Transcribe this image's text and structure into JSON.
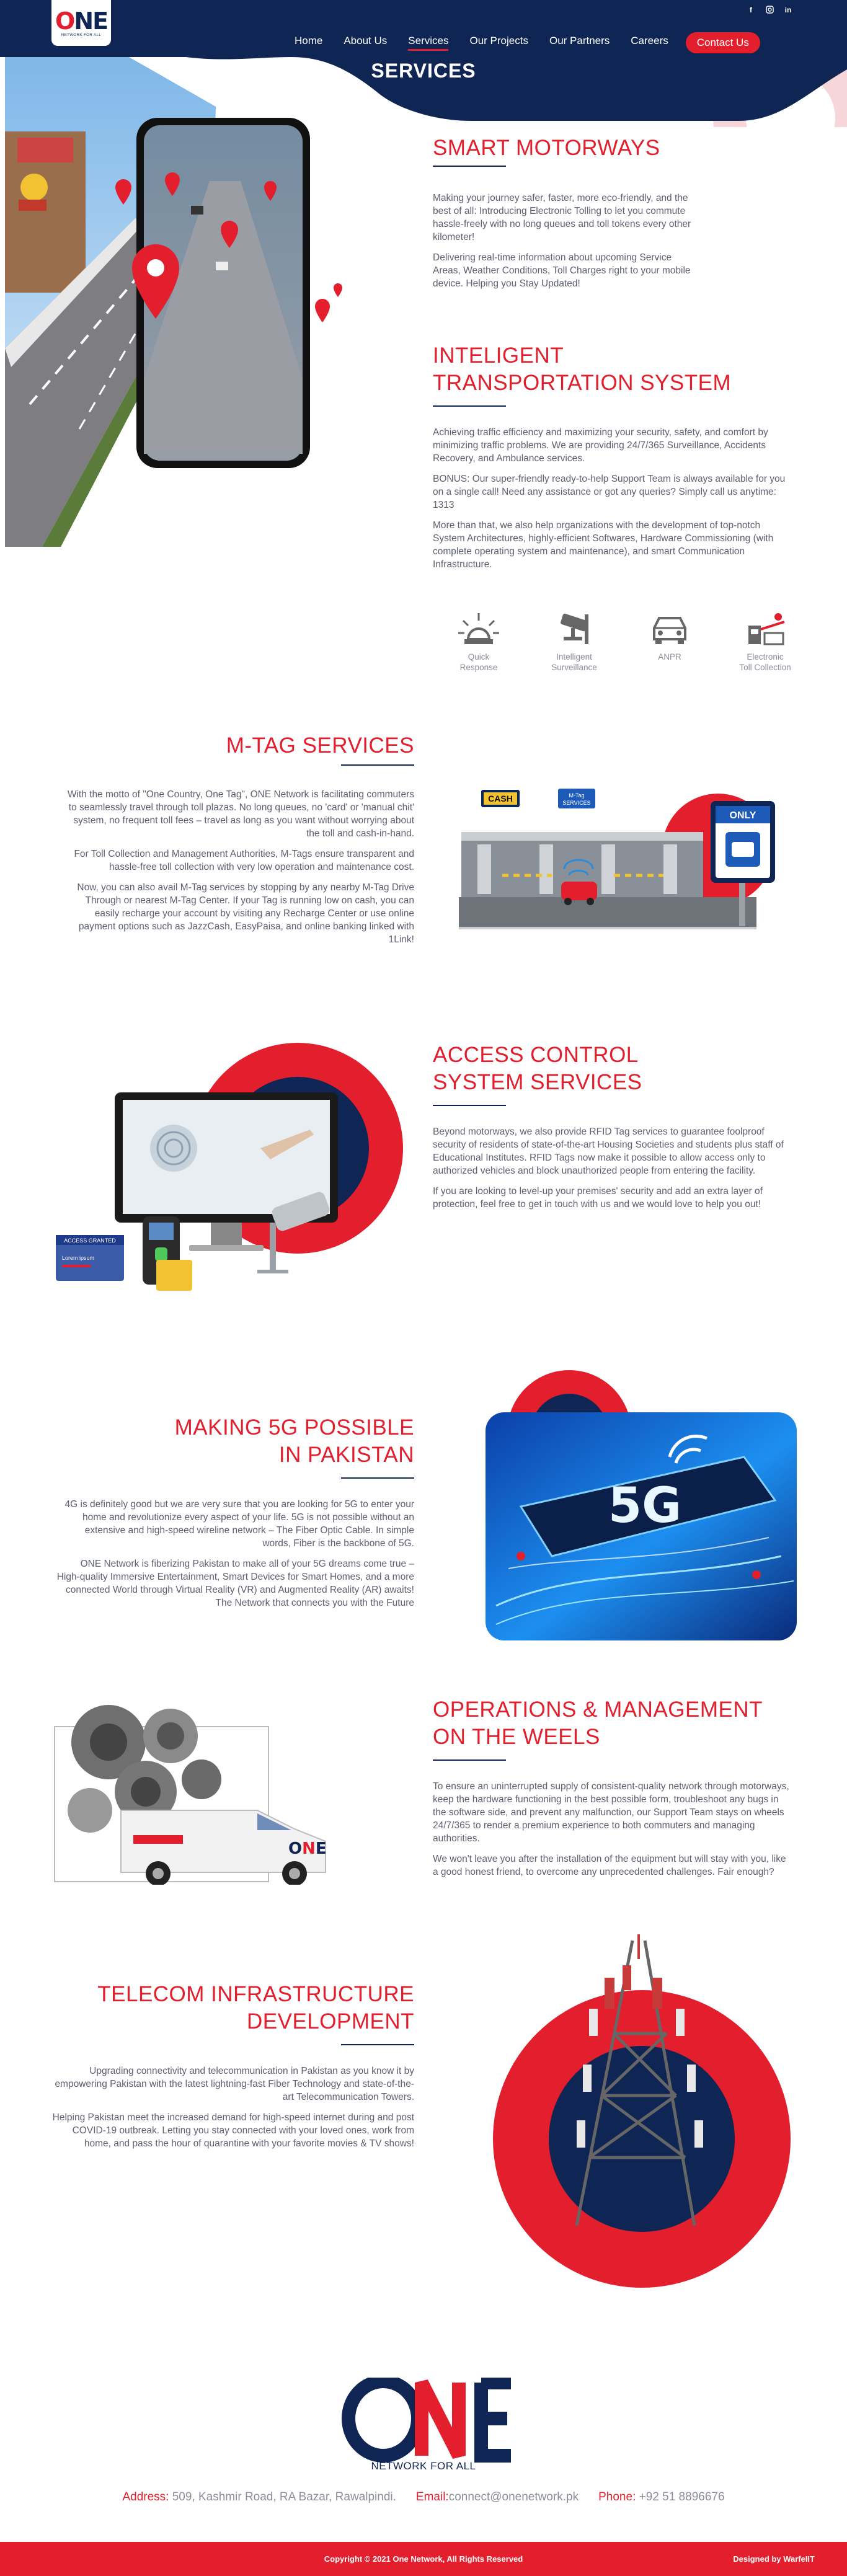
{
  "header": {
    "logo_text_o": "O",
    "logo_text_ne": "NE",
    "logo_sub": "NETWORK FOR ALL",
    "social": [
      "f",
      "ig",
      "in"
    ],
    "nav": [
      "Home",
      "About Us",
      "Services",
      "Our Projects",
      "Our Partners",
      "Careers"
    ],
    "active_nav": "Services",
    "contact_label": "Contact Us",
    "page_title": "SERVICES"
  },
  "sections": {
    "smart_motorways": {
      "title": "SMART MOTORWAYS",
      "paragraphs": [
        "Making your journey safer, faster, more eco-friendly, and the best of all: Introducing Electronic Tolling to let you commute hassle-freely with no long queues and toll tokens every other kilometer!",
        "Delivering real-time information about upcoming Service Areas, Weather Conditions, Toll Charges right to your mobile device. Helping you Stay Updated!"
      ]
    },
    "its": {
      "title_line1": "INTELIGENT",
      "title_line2": "TRANSPORTATION SYSTEM",
      "paragraphs": [
        "Achieving traffic efficiency and maximizing your security, safety, and comfort by minimizing traffic problems. We are providing 24/7/365 Surveillance, Accidents Recovery, and Ambulance services.",
        "BONUS: Our super-friendly ready-to-help Support Team is always available for you on a single call! Need any assistance or got any queries? Simply call us anytime: 1313",
        "More than that, we also help organizations with the development of top-notch System Architectures, highly-efficient Softwares, Hardware Commissioning (with complete operating system and maintenance), and smart Communication Infrastructure."
      ],
      "features": [
        {
          "icon": "siren-icon",
          "label_1": "Quick",
          "label_2": "Response"
        },
        {
          "icon": "cctv-icon",
          "label_1": "Intelligent",
          "label_2": "Surveillance"
        },
        {
          "icon": "car-icon",
          "label_1": "ANPR",
          "label_2": ""
        },
        {
          "icon": "toll-icon",
          "label_1": "Electronic",
          "label_2": "Toll Collection"
        }
      ]
    },
    "mtag": {
      "title": "M-TAG SERVICES",
      "paragraphs": [
        "With the motto of \"One Country, One Tag\", ONE Network is facilitating commuters to seamlessly travel through toll plazas. No long queues, no 'card' or 'manual chit' system, no frequent toll fees – travel as long as you want without worrying about the toll and cash-in-hand.",
        "For Toll Collection and Management Authorities, M-Tags ensure transparent and hassle-free toll collection with very low operation and maintenance cost.",
        "Now, you can also avail M-Tag services by stopping by any nearby M-Tag Drive Through or nearest M-Tag Center. If your Tag is running low on cash, you can easily recharge your account by visiting any Recharge Center or use online payment options such as JazzCash, EasyPaisa, and online banking linked with 1Link!"
      ],
      "sign_cash": "CASH",
      "sign_mtag": "M-Tag SERVICES",
      "sign_only": "ONLY"
    },
    "access": {
      "title_line1": "ACCESS CONTROL",
      "title_line2": "SYSTEM SERVICES",
      "paragraphs": [
        "Beyond motorways, we also provide RFID Tag services to guarantee foolproof security of residents of state-of-the-art Housing Societies and students plus staff of Educational Institutes. RFID Tags now make it possible to allow access only to authorized vehicles and block unauthorized people from entering the facility.",
        "If you are looking to level-up your premises' security and add an extra layer of protection, feel free to get in touch with us and we would love to help you out!"
      ],
      "card_title": "ACCESS GRANTED",
      "card_sub": "Lorem ipsum"
    },
    "fiveg": {
      "title_line1": "MAKING 5G POSSIBLE",
      "title_line2": "IN PAKISTAN",
      "paragraphs": [
        "4G is definitely good but we are very sure that you are looking for 5G to enter your home and revolutionize every aspect of your life. 5G is not possible without an extensive and high-speed wireline network – The Fiber Optic Cable. In simple words, Fiber is the backbone of 5G.",
        "ONE Network is fiberizing Pakistan to make all of your 5G dreams come true – High-quality Immersive Entertainment, Smart Devices for Smart Homes, and a more connected World through Virtual Reality (VR) and Augmented Reality (AR) awaits! The Network that connects you with the Future"
      ],
      "badge": "5G"
    },
    "operations": {
      "title_line1": "OPERATIONS & MANAGEMENT",
      "title_line2": "ON THE WEELS",
      "paragraphs": [
        "To ensure an uninterrupted supply of consistent-quality network through motorways, keep the hardware functioning in the best possible form, troubleshoot any bugs in the software side, and prevent any malfunction, our Support Team stays on wheels 24/7/365 to render a premium experience to both commuters and managing authorities.",
        "We won't leave you after the installation of the equipment but will stay with you, like a good honest friend, to overcome any unprecedented challenges. Fair enough?"
      ]
    },
    "telecom": {
      "title_line1": "TELECOM INFRASTRUCTURE",
      "title_line2": "DEVELOPMENT",
      "paragraphs": [
        "Upgrading connectivity and telecommunication in Pakistan as you know it by empowering Pakistan with the latest lightning-fast Fiber Technology and state-of-the-art Telecommunication Towers.",
        "Helping Pakistan meet the increased demand for high-speed internet during and post COVID-19 outbreak. Letting you stay connected with your loved ones, work from home, and pass the hour of quarantine with your favorite movies & TV shows!"
      ]
    }
  },
  "footer": {
    "logo_o": "O",
    "logo_ne": "NE",
    "tagline": "NETWORK FOR ALL",
    "address_label": "Address:",
    "address": "509, Kashmir Road, RA Bazar, Rawalpindi.",
    "email_label": "Email:",
    "email": "connect@onenetwork.pk",
    "phone_label": "Phone:",
    "phone": "+92 51 8896676",
    "copyright": "Copyright © 2021 One Network, All Rights Reserved",
    "designed_by": "Designed by WarfeIIT"
  },
  "colors": {
    "navy": "#0f2554",
    "red": "#e31e2d",
    "pink": "#f7d6d9"
  }
}
